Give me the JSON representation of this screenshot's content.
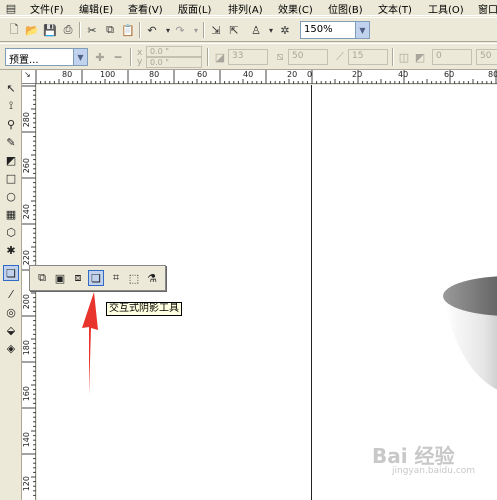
{
  "menu": {
    "items": [
      {
        "label": "文件(F)"
      },
      {
        "label": "编辑(E)"
      },
      {
        "label": "查看(V)"
      },
      {
        "label": "版面(L)"
      },
      {
        "label": "排列(A)"
      },
      {
        "label": "效果(C)"
      },
      {
        "label": "位图(B)"
      },
      {
        "label": "文本(T)"
      },
      {
        "label": "工具(O)"
      },
      {
        "label": "窗口"
      }
    ]
  },
  "toolbar1": {
    "zoom_value": "150%"
  },
  "toolbar2": {
    "preset_value": "预置...",
    "offset_x": "0.0 \"",
    "offset_y": "0.0 \"",
    "opacity": "33",
    "feather": "50",
    "direction": "15",
    "fade": "0",
    "stretch": "50"
  },
  "ruler": {
    "h_labels": [
      "80",
      "100",
      "80",
      "60",
      "40",
      "20",
      "0",
      "20",
      "40",
      "60",
      "80"
    ],
    "v_labels": [
      "280",
      "260",
      "240",
      "220",
      "200",
      "180",
      "160",
      "140",
      "120"
    ]
  },
  "tooltip": {
    "text": "交互式阴影工具"
  },
  "colors": {
    "chrome": "#ece9d8",
    "highlight": "#c1d2ee",
    "arrow": "#e8342c"
  },
  "watermark": {
    "text": "Bai 经验",
    "sub": "jingyan.baidu.com"
  }
}
